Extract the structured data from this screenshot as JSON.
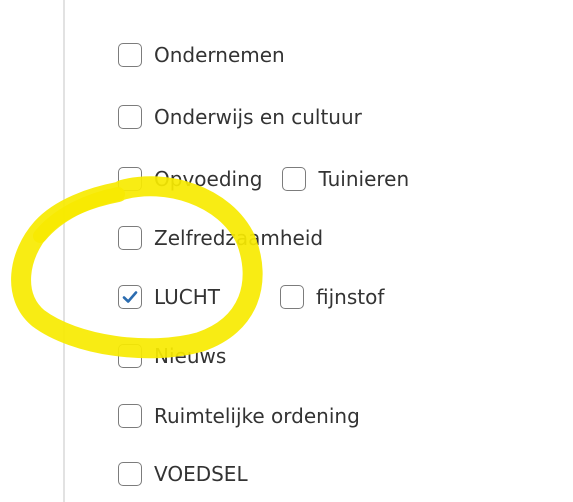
{
  "colors": {
    "highlight": "#f7ea00",
    "checkbox_border": "#7c7c7c",
    "checkmark": "#2b6cb0",
    "text": "#333333"
  },
  "options": [
    {
      "label": "Ondernemen",
      "checked": false,
      "icon": "checkbox-empty"
    },
    {
      "label": "Onderwijs en cultuur",
      "checked": false,
      "icon": "checkbox-empty"
    },
    {
      "label": "Opvoeding",
      "checked": false,
      "icon": "checkbox-empty"
    },
    {
      "label": "Tuinieren",
      "checked": false,
      "icon": "checkbox-empty"
    },
    {
      "label": "Zelfredzaamheid",
      "checked": false,
      "icon": "checkbox-empty"
    },
    {
      "label": "LUCHT",
      "checked": true,
      "icon": "checkmark-icon"
    },
    {
      "label": "fijnstof",
      "checked": false,
      "icon": "checkbox-empty"
    },
    {
      "label": "Nieuws",
      "checked": false,
      "icon": "checkbox-empty"
    },
    {
      "label": "Ruimtelijke ordening",
      "checked": false,
      "icon": "checkbox-empty"
    },
    {
      "label": "VOEDSEL",
      "checked": false,
      "icon": "checkbox-empty"
    }
  ]
}
